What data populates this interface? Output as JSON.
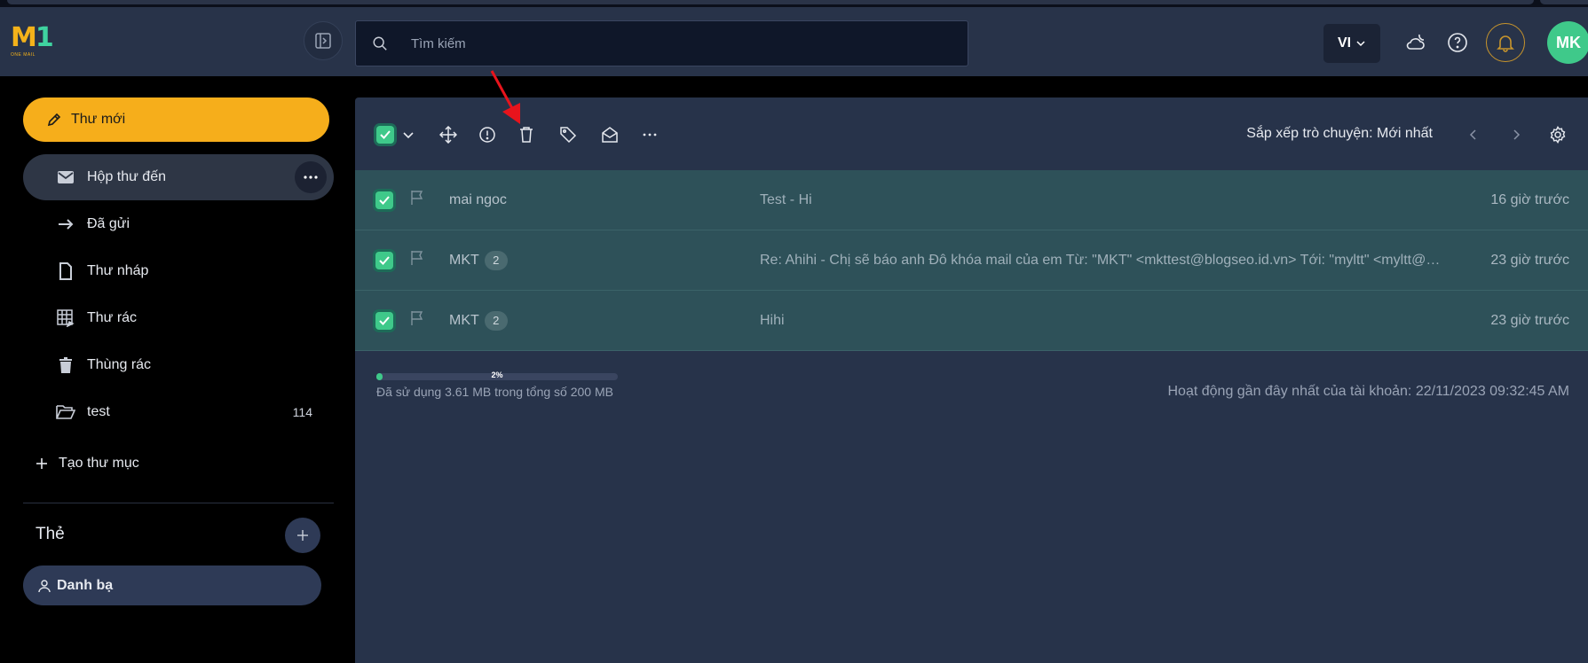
{
  "colors": {
    "accent": "#f6ae1b",
    "selected_row": "#2e5159",
    "checkbox": "#3fc98a",
    "panel": "#27334a",
    "header": "#283349"
  },
  "header": {
    "logo_mark": "M1",
    "logo_text": "ONE MAIL",
    "search_placeholder": "Tìm kiếm",
    "language": "VI",
    "avatar_initials": "MK"
  },
  "sidebar": {
    "compose_label": "Thư mới",
    "items": [
      {
        "label": "Hộp thư đến",
        "icon": "inbox-icon",
        "active": true
      },
      {
        "label": "Đã gửi",
        "icon": "sent-arrow-icon"
      },
      {
        "label": "Thư nháp",
        "icon": "draft-icon"
      },
      {
        "label": "Thư rác",
        "icon": "spam-icon"
      },
      {
        "label": "Thùng rác",
        "icon": "trash-icon"
      },
      {
        "label": "test",
        "icon": "folder-open-icon",
        "count": "114"
      }
    ],
    "create_folder_label": "Tạo thư mục",
    "tags_title": "Thẻ",
    "contacts_label": "Danh bạ"
  },
  "toolbar": {
    "sort_label": "Sắp xếp trò chuyện: Mới nhất"
  },
  "emails": [
    {
      "sender": "mai ngoc",
      "count": "",
      "subject": "Test - Hi",
      "time": "16 giờ trước",
      "selected": true
    },
    {
      "sender": "MKT",
      "count": "2",
      "subject": "Re: Ahihi - Chị sẽ báo anh Đô khóa mail của em Từ: \"MKT\" <mkttest@blogseo.id.vn> Tới: \"myltt\" <myltt@blogseo.id.vn>",
      "time": "23 giờ trước",
      "selected": true
    },
    {
      "sender": "MKT",
      "count": "2",
      "subject": "Hihi",
      "time": "23 giờ trước",
      "selected": true
    }
  ],
  "storage": {
    "percent_label": "2%",
    "used_fraction": 0.02,
    "text": "Đã sử dụng 3.61 MB trong tổng số 200 MB"
  },
  "activity_text": "Hoạt động gần đây nhất của tài khoản: 22/11/2023 09:32:45 AM"
}
